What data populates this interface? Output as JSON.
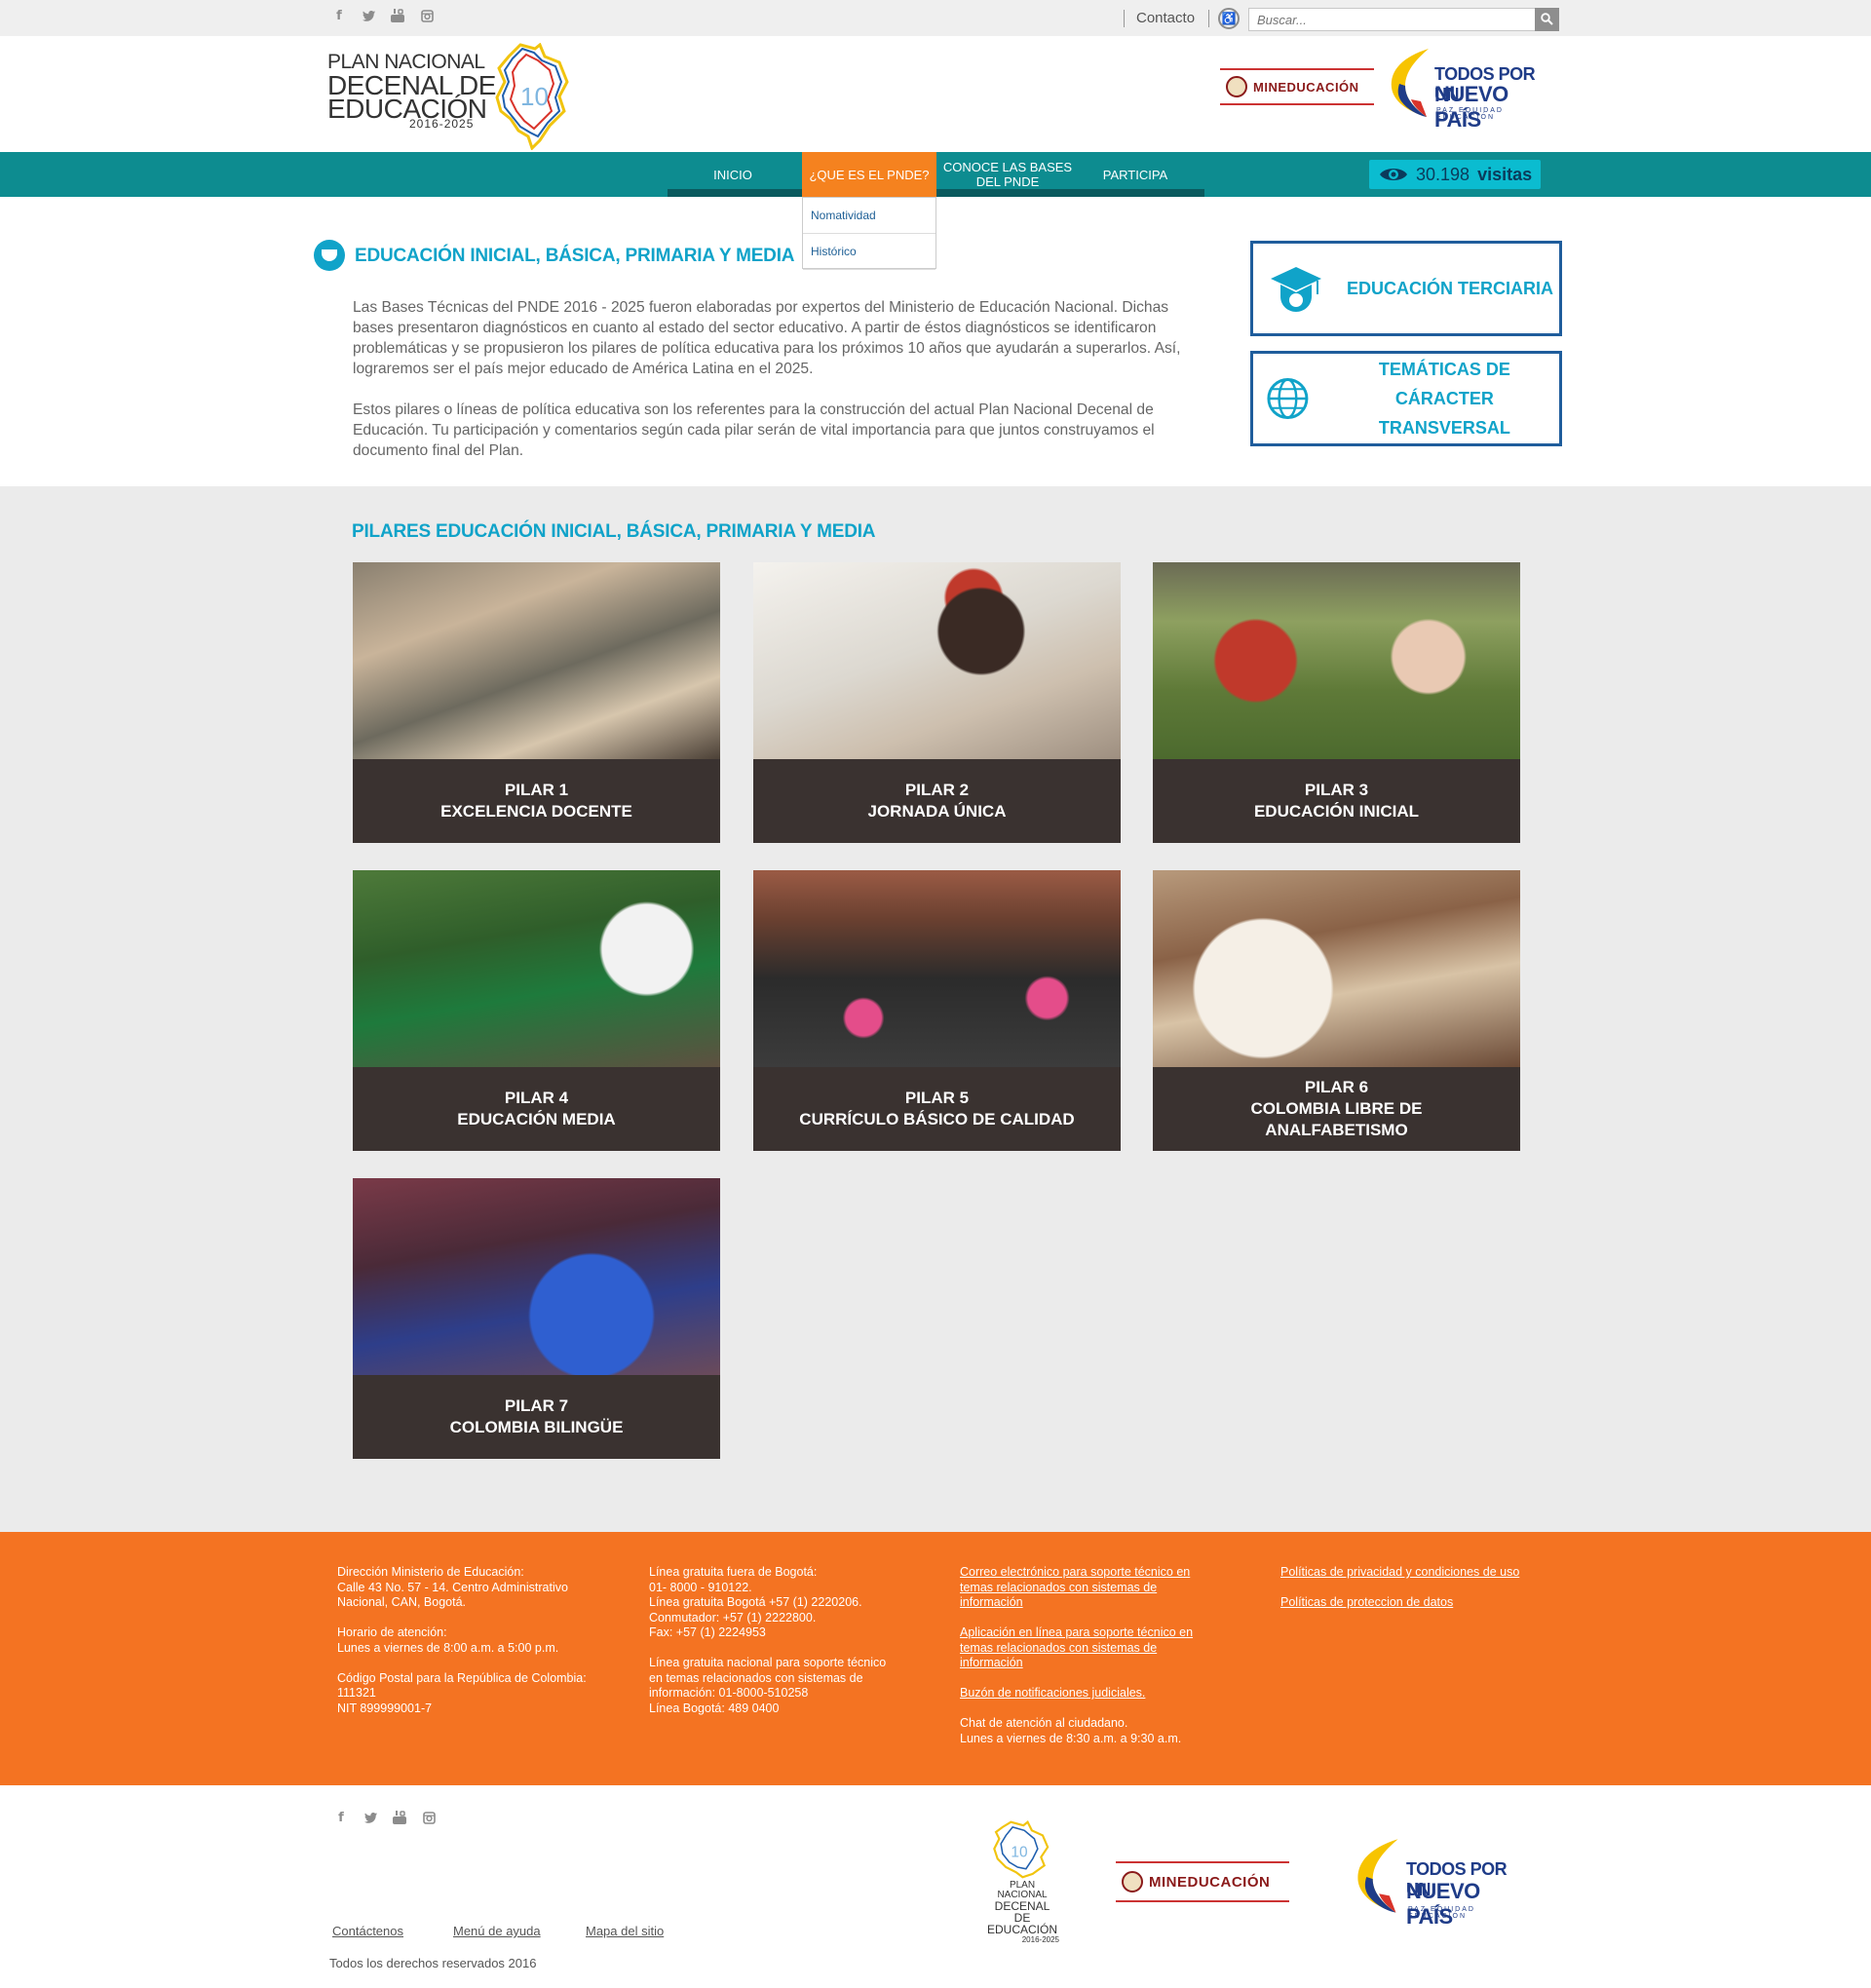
{
  "topbar": {
    "social": [
      "f",
      "t",
      "yt",
      "ig"
    ],
    "contact": "Contacto",
    "accessibility_icon": "accessibility-icon",
    "search_placeholder": "Buscar..."
  },
  "header": {
    "logo": {
      "line1": "PLAN NACIONAL",
      "line2": "DECENAL DE",
      "line3": "EDUCACIÓN",
      "line4": "2016-2025"
    },
    "minedu": "MINEDUCACIÓN",
    "todos": {
      "w1": "TODOS POR UN",
      "w2": "NUEVO PAÍS",
      "w3": "PAZ   EQUIDAD   EDUCACIÓN"
    }
  },
  "nav": {
    "items": [
      {
        "label": "INICIO"
      },
      {
        "label": "¿QUE ES EL PNDE?"
      },
      {
        "label": "CONOCE LAS BASES DEL PNDE"
      },
      {
        "label": "PARTICIPA"
      }
    ],
    "visits_count": "30.198",
    "visits_label": "visitas",
    "dropdown": [
      "Nomatividad",
      "Histórico"
    ]
  },
  "intro": {
    "title": "EDUCACIÓN INICIAL, BÁSICA,  PRIMARIA Y MEDIA",
    "p1": "Las Bases Técnicas del PNDE 2016 - 2025 fueron elaboradas por expertos del Ministerio de Educación Nacional. Dichas bases presentaron diagnósticos en cuanto al estado del sector educativo. A partir de éstos diagnósticos se identificaron problemáticas y se propusieron los pilares de política educativa para los próximos 10 años que ayudarán a superarlos. Así, lograremos ser el país mejor educado de América Latina en el 2025.",
    "p2": "Estos pilares o líneas de política educativa son los referentes para la construcción del actual Plan Nacional Decenal de Educación. Tu participación y comentarios según cada pilar serán de vital importancia para que juntos construyamos el documento final del Plan."
  },
  "sidebar": {
    "box1": "EDUCACIÓN TERCIARIA",
    "box2_l1": "TEMÁTICAS DE CÁRACTER",
    "box2_l2": "TRANSVERSAL"
  },
  "pillars": {
    "title": "PILARES EDUCACIÓN INICIAL, BÁSICA, PRIMARIA Y MEDIA",
    "items": [
      {
        "num": "PILAR 1",
        "name": "EXCELENCIA DOCENTE",
        "name2": ""
      },
      {
        "num": "PILAR 2",
        "name": "JORNADA ÚNICA",
        "name2": ""
      },
      {
        "num": "PILAR 3",
        "name": "EDUCACIÓN INICIAL",
        "name2": ""
      },
      {
        "num": "PILAR 4",
        "name": "EDUCACIÓN MEDIA",
        "name2": ""
      },
      {
        "num": "PILAR 5",
        "name": "CURRÍCULO BÁSICO DE CALIDAD",
        "name2": ""
      },
      {
        "num": "PILAR 6",
        "name": "COLOMBIA LIBRE DE",
        "name2": "ANALFABETISMO"
      },
      {
        "num": "PILAR 7",
        "name": "COLOMBIA BILINGÜE",
        "name2": ""
      }
    ]
  },
  "footer": {
    "col1": [
      "Dirección Ministerio de Educación:",
      "Calle 43 No. 57 - 14. Centro Administrativo",
      "Nacional, CAN, Bogotá.",
      "",
      "Horario de atención:",
      "Lunes a viernes de 8:00 a.m. a 5:00 p.m.",
      "",
      "Código Postal para la República de Colombia:",
      "111321",
      "NIT 899999001-7"
    ],
    "col2": [
      "Línea gratuita fuera de Bogotá:",
      "01- 8000 - 910122.",
      "Línea gratuita Bogotá +57 (1) 2220206.",
      "Conmutador: +57 (1) 2222800.",
      "Fax: +57 (1) 2224953",
      "",
      "Línea gratuita nacional para soporte técnico",
      "en temas relacionados con sistemas de",
      "información: 01-8000-510258",
      "Línea Bogotá: 489 0400"
    ],
    "col3_links": [
      "Correo electrónico para soporte técnico en temas relacionados con sistemas de información",
      "Aplicación en línea para soporte técnico en temas relacionados con sistemas de información",
      "Buzón de notificaciones judiciales."
    ],
    "col3_text1": "Chat de atención al ciudadano.",
    "col3_text2": "Lunes a viernes de 8:30 a.m. a 9:30 a.m.",
    "col4_links": [
      "Políticas de privacidad y condiciones de uso",
      "Políticas de proteccion de datos"
    ]
  },
  "bottom": {
    "links": [
      "Contáctenos",
      "Menú de ayuda",
      "Mapa del sitio"
    ],
    "copyright": "Todos los derechos reservados 2016",
    "logo_l1": "PLAN NACIONAL",
    "logo_l2": "DECENAL DE",
    "logo_l3": "EDUCACIÓN",
    "logo_l4": "2016-2025"
  }
}
